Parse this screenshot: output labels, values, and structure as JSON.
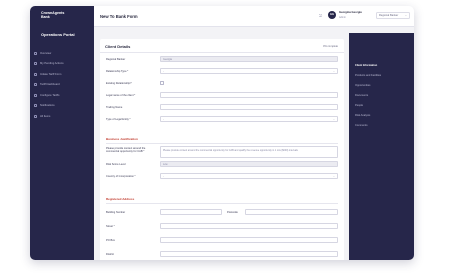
{
  "sidebar": {
    "brand": "CrownAgents\nBank",
    "portal": "Operations Portal",
    "items": [
      {
        "label": "Overview",
        "icon": "overview-icon"
      },
      {
        "label": "My Pending Actions",
        "icon": "pending-icon"
      },
      {
        "label": "Initiate Tariff Form",
        "icon": "form-icon"
      },
      {
        "label": "Tariff Dashboard",
        "icon": "dashboard-icon"
      },
      {
        "label": "Configure Tariffs",
        "icon": "configure-icon"
      },
      {
        "label": "Notifications",
        "icon": "bell-icon"
      },
      {
        "label": "All Items",
        "icon": "list-icon"
      }
    ]
  },
  "topbar": {
    "title": "New To Bank Form",
    "avatar": "GG",
    "user_name": "Georgina Georgiu",
    "user_role": "Admin",
    "region": "Regional Banker"
  },
  "form": {
    "title": "Client Details",
    "percent": "0% complete",
    "fields": [
      {
        "label": "Regional Banker",
        "value": "Georgia",
        "kind": "disabled"
      },
      {
        "label": "Relationship Type *",
        "value": "-",
        "kind": "select"
      },
      {
        "label": "Existing Relationship?",
        "value": "",
        "kind": "checkbox"
      },
      {
        "label": "Legal name of the client *",
        "value": "",
        "kind": "input"
      },
      {
        "label": "Trading Name",
        "value": "",
        "kind": "input"
      },
      {
        "label": "Type of Legal Entity *",
        "value": "-",
        "kind": "select"
      }
    ],
    "business": {
      "title": "Business Justification",
      "rationale_label": "Please provide context around the commercial opportunity for CAB *",
      "rationale_text": "Please provide context around the commercial opportunity for CAB and qualify the revenue opportunity in 1 row ($000) intervals",
      "risk_label": "Risk Score Level",
      "risk_value": "Low",
      "country_label": "Country of Incorporation *",
      "country_value": "-"
    },
    "address": {
      "title": "Registered Address",
      "building_label": "Building Number",
      "postcode_label": "Postcode",
      "street_label": "Street *",
      "po_label": "PO Box",
      "district_label": "District"
    }
  },
  "right_panel": {
    "items": [
      {
        "label": "Client Information",
        "active": true
      },
      {
        "label": "Products and Facilities",
        "active": false
      },
      {
        "label": "Opportunities",
        "active": false
      },
      {
        "label": "Documents",
        "active": false
      },
      {
        "label": "People",
        "active": false
      },
      {
        "label": "Risk Analysis",
        "active": false
      },
      {
        "label": "Comments",
        "active": false
      }
    ]
  }
}
